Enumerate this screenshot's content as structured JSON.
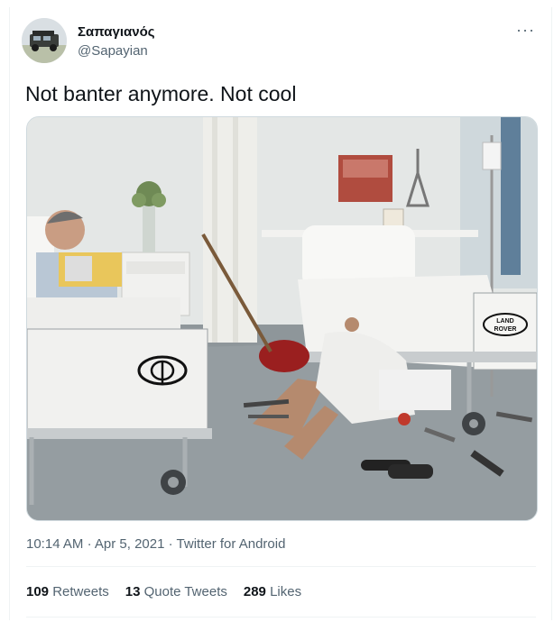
{
  "user": {
    "display_name": "Σαπαγιανός",
    "handle": "@Sapayian"
  },
  "header": {
    "more_label": "···"
  },
  "tweet": {
    "text": "Not banter anymore. Not cool"
  },
  "media": {
    "bed_left_logo_alt": "Toyota",
    "bed_right_logo_text_1": "LAND",
    "bed_right_logo_text_2": "ROVER"
  },
  "meta": {
    "time": "10:14 AM",
    "sep1": "·",
    "date": "Apr 5, 2021",
    "sep2": "·",
    "client": "Twitter for Android"
  },
  "stats": {
    "retweets_count": "109",
    "retweets_label": "Retweets",
    "quotes_count": "13",
    "quotes_label": "Quote Tweets",
    "likes_count": "289",
    "likes_label": "Likes"
  },
  "colors": {
    "text": "#0f1419",
    "secondary": "#536471",
    "divider": "#eff3f4"
  }
}
